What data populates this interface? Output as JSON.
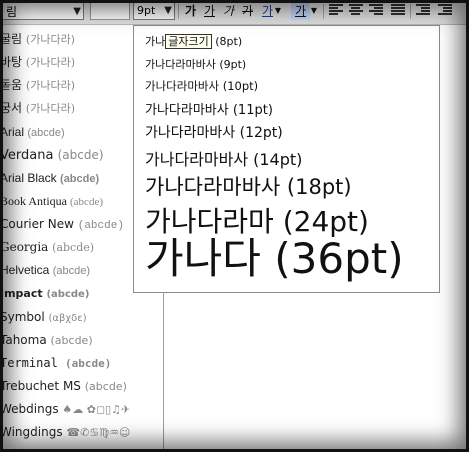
{
  "toolbar": {
    "font_value": "림",
    "size_value": "9pt",
    "bold": "가",
    "underline": "가",
    "italic": "가",
    "strike": "가",
    "font_color": "가",
    "highlight": "가"
  },
  "font_list": [
    {
      "name": "굴림",
      "sample": "(가나다라)"
    },
    {
      "name": "바탕",
      "sample": "(가나다라)"
    },
    {
      "name": "돋움",
      "sample": "(가나다라)"
    },
    {
      "name": "궁서",
      "sample": "(가나다라)"
    },
    {
      "name": "Arial",
      "sample": "(abcde)"
    },
    {
      "name": "Verdana",
      "sample": "(abcde)"
    },
    {
      "name": "Arial Black",
      "sample": "(abcde)"
    },
    {
      "name": "Book Antiqua",
      "sample": "(abcde)"
    },
    {
      "name": "Courier New",
      "sample": "(abcde)"
    },
    {
      "name": "Georgia",
      "sample": "(abcde)"
    },
    {
      "name": "Helvetica",
      "sample": "(abcde)"
    },
    {
      "name": "Impact",
      "sample": "(abcde)"
    },
    {
      "name": "Symbol",
      "sample": "(αβχδε)"
    },
    {
      "name": "Tahoma",
      "sample": "(abcde)"
    },
    {
      "name": "Terminal",
      "sample": "(abcde)"
    },
    {
      "name": "Trebuchet MS",
      "sample": "(abcde)"
    },
    {
      "name": "Webdings",
      "sample": "♠☁ ✿◻▯♫✈"
    },
    {
      "name": "Wingdings",
      "sample": "☎✆♋♍♒☺"
    }
  ],
  "size_options": {
    "item1_prefix": "가나",
    "item1_tooltip": "글자크기",
    "item1_size": "(8pt)",
    "item2": "가나다라마바사 (9pt)",
    "item3": "가나다라마바사 (10pt)",
    "item4": "가나다라마바사 (11pt)",
    "item5": "가나다라마바사 (12pt)",
    "item6": "가나다라마바사 (14pt)",
    "item7": "가나다라마바사 (18pt)",
    "item8": "가나다라마 (24pt)",
    "item9": "가나다 (36pt)"
  }
}
